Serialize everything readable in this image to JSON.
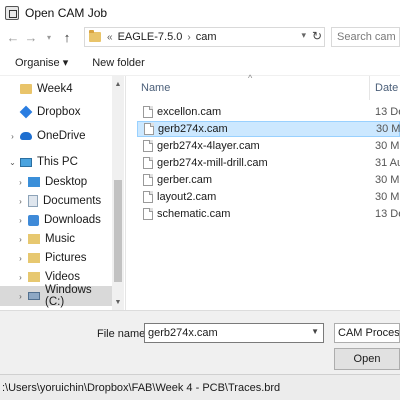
{
  "window": {
    "title": "Open CAM Job",
    "icon": "app-window-icon"
  },
  "address": {
    "breadcrumbs": [
      "EAGLE-7.5.0",
      "cam"
    ],
    "search_placeholder": "Search cam"
  },
  "toolbar": {
    "organise_label": "Organise ▾",
    "new_folder_label": "New folder"
  },
  "nav": {
    "items": [
      {
        "label": "Week4",
        "icon": "folder-icon"
      },
      {
        "label": "Dropbox",
        "icon": "dropbox-icon"
      },
      {
        "label": "OneDrive",
        "icon": "onedrive-icon"
      },
      {
        "label": "This PC",
        "icon": "pc-icon"
      },
      {
        "label": "Desktop",
        "icon": "desktop-icon"
      },
      {
        "label": "Documents",
        "icon": "documents-icon"
      },
      {
        "label": "Downloads",
        "icon": "downloads-icon"
      },
      {
        "label": "Music",
        "icon": "music-icon"
      },
      {
        "label": "Pictures",
        "icon": "pictures-icon"
      },
      {
        "label": "Videos",
        "icon": "videos-icon"
      },
      {
        "label": "Windows (C:)",
        "icon": "drive-icon"
      }
    ]
  },
  "files": {
    "columns": {
      "name": "Name",
      "date": "Date"
    },
    "rows": [
      {
        "name": "excellon.cam",
        "date": "13 De"
      },
      {
        "name": "gerb274x.cam",
        "date": "30 M"
      },
      {
        "name": "gerb274x-4layer.cam",
        "date": "30 M"
      },
      {
        "name": "gerb274x-mill-drill.cam",
        "date": "31 Au"
      },
      {
        "name": "gerber.cam",
        "date": "30 M"
      },
      {
        "name": "layout2.cam",
        "date": "30 M"
      },
      {
        "name": "schematic.cam",
        "date": "13 De"
      }
    ]
  },
  "bottom": {
    "file_name_label": "File name:",
    "file_name_value": "gerb274x.cam",
    "file_type_value": "CAM Processor",
    "open_label": "Open"
  },
  "status": {
    "path": ":\\Users\\yoruichin\\Dropbox\\FAB\\Week 4 - PCB\\Traces.brd"
  }
}
